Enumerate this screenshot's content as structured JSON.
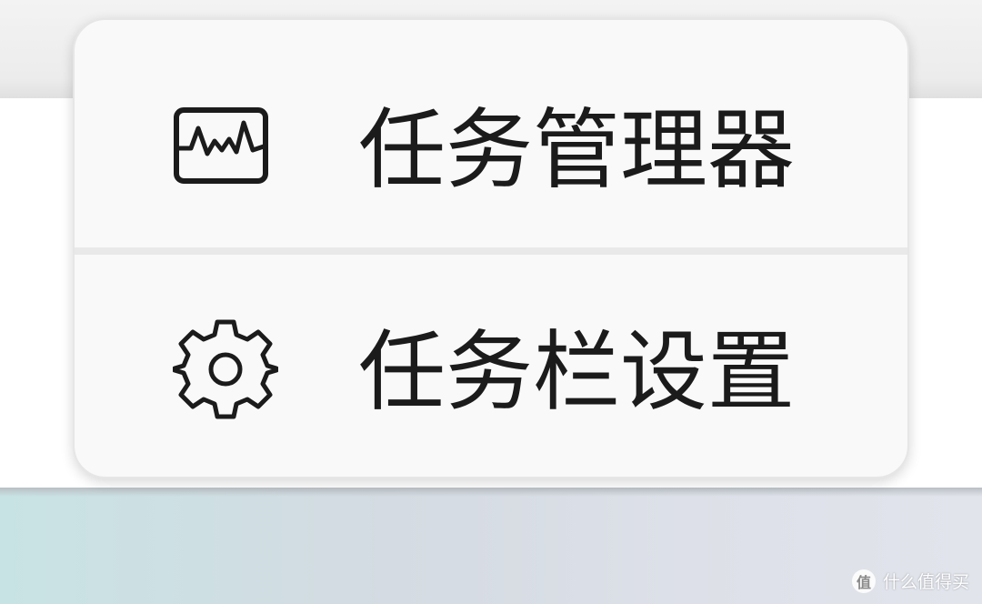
{
  "context_menu": {
    "items": [
      {
        "label": "任务管理器",
        "icon": "task-manager-icon"
      },
      {
        "label": "任务栏设置",
        "icon": "gear-icon"
      }
    ]
  },
  "watermark": {
    "logo_glyph": "值",
    "text": "什么值得买"
  },
  "colors": {
    "menu_background": "#f9f9f9",
    "separator": "#e9e9e9",
    "text": "#1b1b1b"
  }
}
